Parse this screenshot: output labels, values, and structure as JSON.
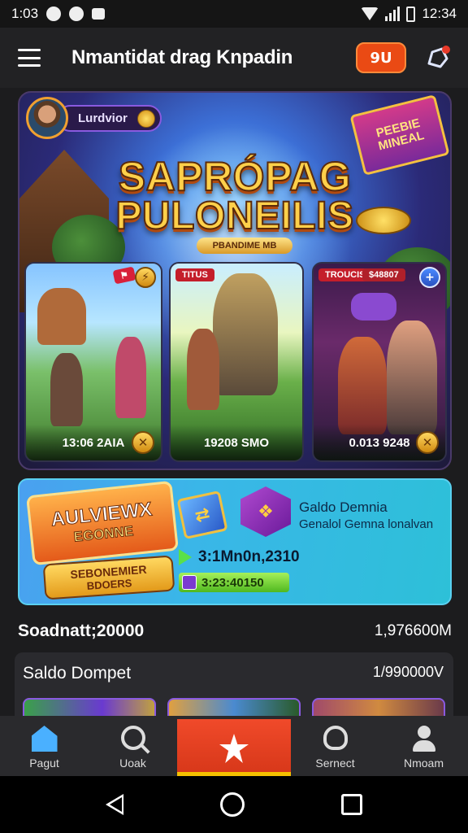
{
  "status_bar": {
    "time_left": "1:03",
    "time_right": "12:34"
  },
  "header": {
    "title": "Nmantidat drag Knpadin",
    "badge": "9U"
  },
  "hero": {
    "user_name": "Lurdvior",
    "promo_flag": "PEEBIE MINEAL",
    "title_line1": "SAPRÓPAG",
    "title_line2": "PULONEILIS",
    "subtitle": "PBANDIME MB",
    "cards": [
      {
        "tag": "",
        "caption": "13:06 2AIA"
      },
      {
        "tag": "TITUS",
        "caption": "19208 SMO"
      },
      {
        "tag": "TROUCIS",
        "badge_text": "$48807",
        "caption": "0.013 9248"
      }
    ]
  },
  "wallet_banner": {
    "logo_line1": "AULVIEWX",
    "logo_line2": "EGONNE",
    "pill_line1": "SEBONEMIER",
    "pill_line2": "BDOERS",
    "title": "Galdo Demnia",
    "description": "Genalol Gemna lonalvan",
    "amount": "3:1Mn0n,2310",
    "bonus": "3:23:40150"
  },
  "summary": {
    "label": "Soadnatt;20000",
    "value": "1,976600M"
  },
  "wallet_card": {
    "title": "Saldo Dompet",
    "value": "1/990000V"
  },
  "bottom_nav": [
    {
      "label": "Pagut",
      "icon": "home-icon",
      "active": true
    },
    {
      "label": "Uoak",
      "icon": "search-icon"
    },
    {
      "label": "",
      "icon": "star-icon"
    },
    {
      "label": "Sernect",
      "icon": "support-icon"
    },
    {
      "label": "Nmoam",
      "icon": "user-icon"
    }
  ],
  "colors": {
    "accent_orange": "#ea4a14",
    "nav_center": "#f04a2a",
    "active_blue": "#4ab0ff"
  }
}
